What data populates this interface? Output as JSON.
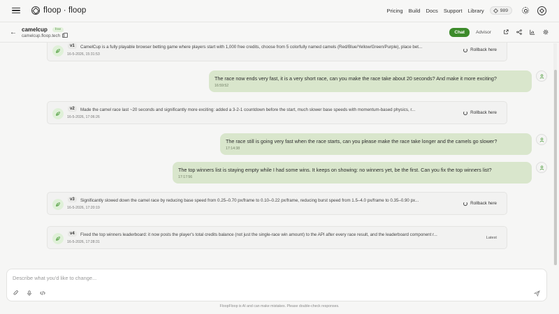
{
  "app": {
    "logo_text": "floop · floop"
  },
  "nav": {
    "pricing": "Pricing",
    "build": "Build",
    "docs": "Docs",
    "support": "Support",
    "library": "Library",
    "credits": "989"
  },
  "project": {
    "name": "camelcup",
    "badge": "free",
    "url": "camelcup.floop.tech",
    "tab_chat": "Chat",
    "tab_advisor": "Advisor"
  },
  "versions": [
    {
      "label": "v1",
      "text": "CamelCup is a fully playable browser betting game where players start with 1,000 free credits, choose from 5 colorfully named camels (Red/Blue/Yellow/Green/Purple), place bet...",
      "time": "16-5-2026, 15:31:53",
      "action": "Rollback here"
    },
    {
      "label": "v2",
      "text": "Made the camel race last ~20 seconds and significantly more exciting: added a 3-2-1 countdown before the start, much slower base speeds with momentum-based physics, r...",
      "time": "16-5-2026, 17:06:26",
      "action": "Rollback here"
    },
    {
      "label": "v3",
      "text": "Significantly slowed down the camel race by reducing base speed from 0.25–0.70 px/frame to 0.10–0.22 px/frame, reducing burst speed from 1.5–4.0 px/frame to 0.35–0.90 px...",
      "time": "16-5-2026, 17:20:19",
      "action": "Rollback here"
    },
    {
      "label": "v4",
      "text": "Fixed the top winners leaderboard: it now posts the player's total credits balance (not just the single-race win amount) to the API after every race result, and the leaderboard component r...",
      "time": "16-5-2026, 17:28:31",
      "action": "Latest"
    }
  ],
  "messages": [
    {
      "text": "The race now ends very fast, it is a very short race, can you make the race take about 20 seconds? And make it more exciting?",
      "time": "16:59:52"
    },
    {
      "text": "The race still is going very fast when the race starts, can you please make the race take longer and the camels go slower?",
      "time": "17:14:38"
    },
    {
      "text": "The top winners list is staying empty while I had some wins. It keeps on showing: no winners yet, be the first. Can you fix the top winners list?",
      "time": "17:17:56"
    }
  ],
  "composer": {
    "placeholder": "Describe what you'd like to change..."
  },
  "footer": {
    "note": "FloopFloop is AI and can make mistakes. Please double-check responses."
  },
  "colors": {
    "accent": "#3d8b2b",
    "user_bubble": "#d9e6cc",
    "version_icon_bg": "#dff0d8"
  }
}
